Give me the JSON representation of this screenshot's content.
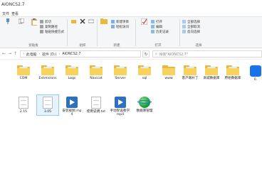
{
  "window": {
    "title": "AIONCS2.7"
  },
  "tabs": [
    "文件",
    "查看"
  ],
  "ribbon": {
    "clipboard": {
      "label": "剪贴板",
      "pin": "固定到快速访问",
      "copy": "复制",
      "paste": "粘贴",
      "cut": "剪切",
      "copy_path": "复制路径",
      "paste_shortcut": "粘贴快捷方式"
    },
    "organize": {
      "label": "组织",
      "move_to": "移动到",
      "copy_to": "复制到",
      "delete": "删除",
      "rename": "重命名"
    },
    "new": {
      "label": "新建",
      "new_folder": "新建文件夹",
      "new_item": "新建项目",
      "easy_access": "轻松访问"
    },
    "open": {
      "label": "打开",
      "properties": "属性",
      "open": "打开",
      "edit": "编辑",
      "history": "历史记录"
    },
    "select": {
      "label": "选择",
      "select_all": "全部选择",
      "select_none": "全部取消",
      "invert": "反向选择"
    }
  },
  "address": {
    "crumbs": [
      "此电脑",
      "软件 (D:)",
      "AIONCS2.7"
    ],
    "search_placeholder": "搜索\"AIONCS2.7\""
  },
  "files_row1": [
    {
      "name": "COM",
      "type": "folder"
    },
    {
      "name": "Extensions",
      "type": "folder"
    },
    {
      "name": "Logs",
      "type": "folder"
    },
    {
      "name": "Navicat",
      "type": "folder"
    },
    {
      "name": "Server",
      "type": "folder"
    },
    {
      "name": "sql",
      "type": "folder"
    },
    {
      "name": "www",
      "type": "folder"
    },
    {
      "name": "客户端补丁",
      "type": "folder"
    },
    {
      "name": "商城数据库",
      "type": "folder"
    },
    {
      "name": "原始数据库",
      "type": "folder"
    },
    {
      "name": "0.",
      "type": "app"
    }
  ],
  "files_row2": [
    {
      "name": "2.15",
      "type": "file"
    },
    {
      "name": "3.05",
      "type": "file"
    },
    {
      "name": "安装视频.mp4",
      "type": "mp4"
    },
    {
      "name": "使用说明.txt",
      "type": "txt"
    },
    {
      "name": "手动架设教学.mp4",
      "type": "mp4"
    },
    {
      "name": "数据库管理",
      "type": "globe"
    }
  ]
}
